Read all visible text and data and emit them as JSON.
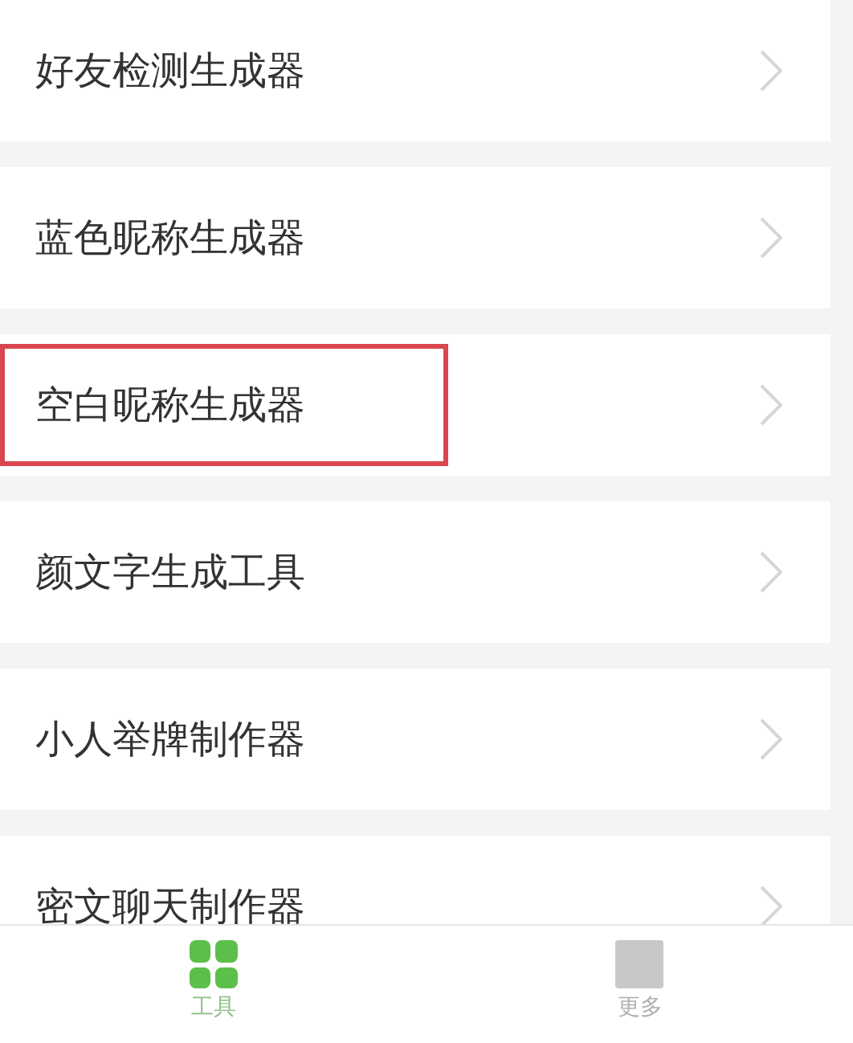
{
  "tools": [
    {
      "label": "好友检测生成器",
      "highlighted": false
    },
    {
      "label": "蓝色昵称生成器",
      "highlighted": false
    },
    {
      "label": "空白昵称生成器",
      "highlighted": true
    },
    {
      "label": "颜文字生成工具",
      "highlighted": false
    },
    {
      "label": "小人举牌制作器",
      "highlighted": false
    },
    {
      "label": "密文聊天制作器",
      "highlighted": false
    }
  ],
  "tab_bar": [
    {
      "label": "工具",
      "selected": true,
      "kind": "grid"
    },
    {
      "label": "更多",
      "selected": false,
      "kind": "square"
    }
  ]
}
